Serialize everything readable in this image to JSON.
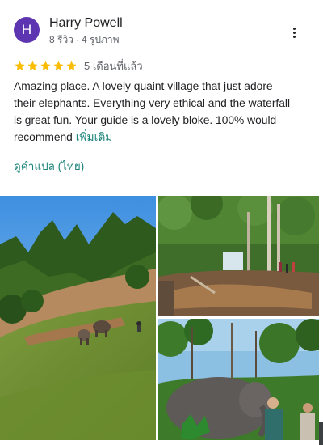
{
  "review": {
    "avatar_letter": "H",
    "avatar_color": "#5e35b1",
    "author": "Harry Powell",
    "reviews_count": "8 รีวิว",
    "separator": "·",
    "photos_count": "4 รูปภาพ",
    "rating": 5,
    "rating_max": 5,
    "star_color": "#fbbc04",
    "time_ago": "5 เดือนที่แล้ว",
    "text": "Amazing place. A lovely quaint village that just adore their elephants. Everything very ethical and the waterfall is great fun. Your guide is a lovely bloke. 100% would recommend",
    "more_label": "เพิ่มเติม",
    "translate_label": "ดูคำแปล (ไทย)",
    "link_color": "#198379"
  },
  "icons": {
    "more": "more-vert-icon",
    "star": "star-icon"
  }
}
